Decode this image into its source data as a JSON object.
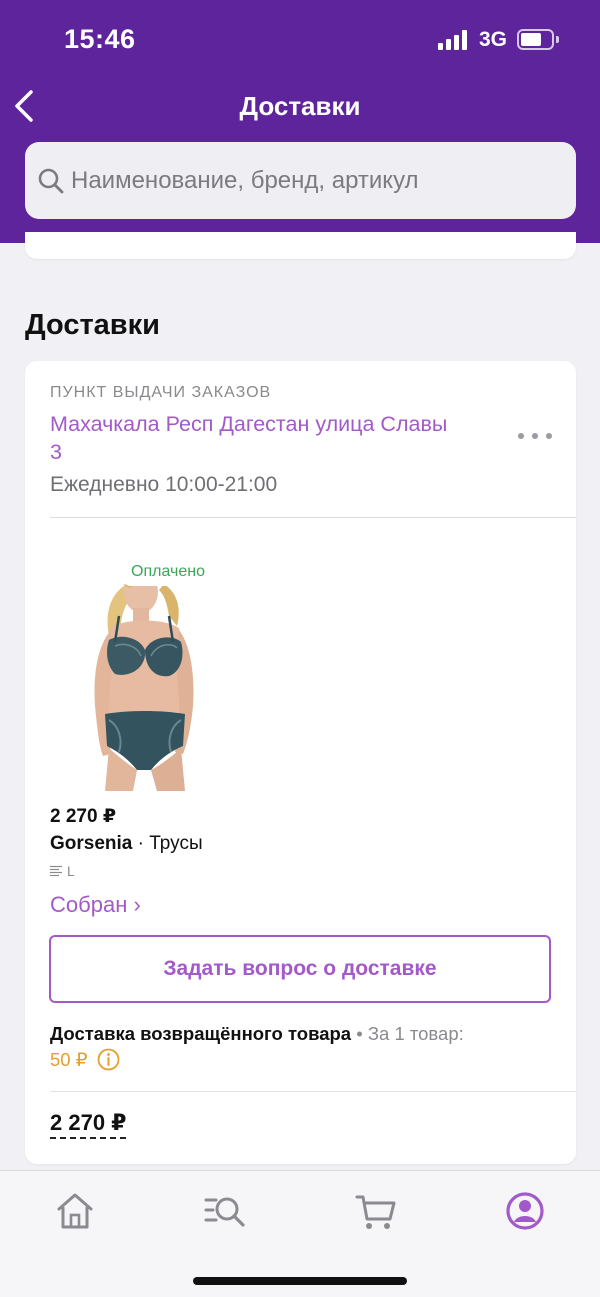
{
  "status_bar": {
    "time": "15:46",
    "network": "3G"
  },
  "header": {
    "title": "Доставки",
    "back_icon": "chevron-left-icon"
  },
  "search": {
    "placeholder": "Наименование, бренд, артикул",
    "icon": "search-icon"
  },
  "section": {
    "title": "Доставки"
  },
  "delivery": {
    "pickup_label": "ПУНКТ ВЫДАЧИ ЗАКАЗОВ",
    "address": "Махачкала Респ Дагестан улица Славы 3",
    "hours": "Ежедневно 10:00-21:00",
    "more_icon": "more-dots-icon"
  },
  "product": {
    "badge": "Оплачено",
    "price": "2 270 ₽",
    "brand": "Gorsenia",
    "separator": " · ",
    "type": "Трусы",
    "size": "L",
    "status": "Собран ›",
    "image_icon": "product-photo"
  },
  "actions": {
    "ask_button": "Задать вопрос о доставке"
  },
  "return_delivery": {
    "title": "Доставка возвращённого товара",
    "extra": " • За 1 товар:",
    "fee": "50 ₽",
    "info_icon": "info-icon"
  },
  "summary": {
    "total": "2 270 ₽"
  },
  "tab_bar": {
    "items": [
      {
        "icon": "home-icon",
        "active": false
      },
      {
        "icon": "catalog-search-icon",
        "active": false
      },
      {
        "icon": "cart-icon",
        "active": false
      },
      {
        "icon": "profile-icon",
        "active": true
      }
    ]
  },
  "colors": {
    "brand_purple": "#5e249c",
    "accent_purple": "#a25ac8",
    "paid_green": "#3aa757",
    "fee_orange": "#e3a02d",
    "tab_inactive": "#8a8a90"
  }
}
